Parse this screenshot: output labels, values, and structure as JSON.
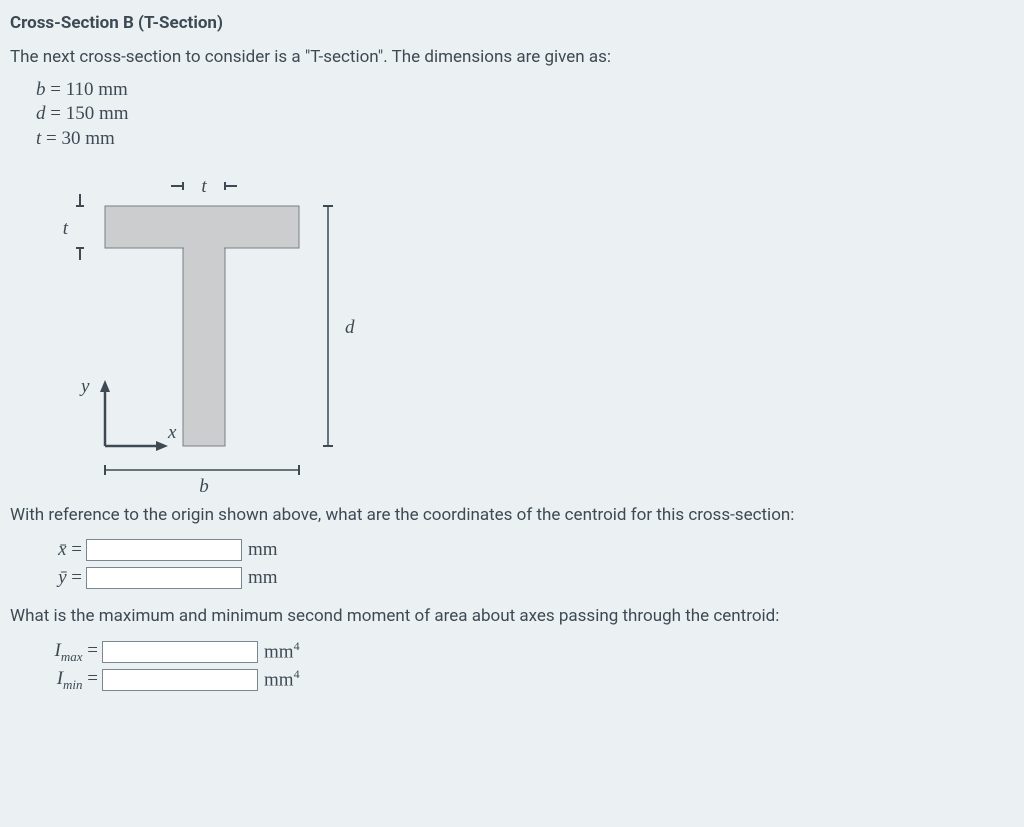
{
  "heading": "Cross-Section B (T-Section)",
  "intro": "The next cross-section to consider is a \"T-section\". The dimensions are given as:",
  "dims": {
    "b": {
      "var": "b",
      "eq": " = ",
      "val": "110 mm"
    },
    "d": {
      "var": "d",
      "eq": " = ",
      "val": "150 mm"
    },
    "t": {
      "var": "t",
      "eq": " = ",
      "val": "30 mm"
    }
  },
  "figure": {
    "t_top": "t",
    "t_left": "t",
    "d_right": "d",
    "b_bottom": "b",
    "y_axis": "y",
    "x_axis": "x"
  },
  "q_centroid": "With reference to the origin shown above, what are the coordinates of the centroid for this cross-section:",
  "centroid": {
    "xlabel_pre": "x̄ = ",
    "xunit": "mm",
    "ylabel_pre": "ȳ = ",
    "yunit": "mm",
    "x_value": "",
    "y_value": ""
  },
  "q_moment": "What is the maximum and minimum second moment of area about axes passing through the centroid:",
  "moment": {
    "imax_var": "I",
    "imax_sub": "max",
    "imin_var": "I",
    "imin_sub": "min",
    "eq": " = ",
    "unit_base": "mm",
    "unit_exp": "4",
    "imax_value": "",
    "imin_value": ""
  }
}
